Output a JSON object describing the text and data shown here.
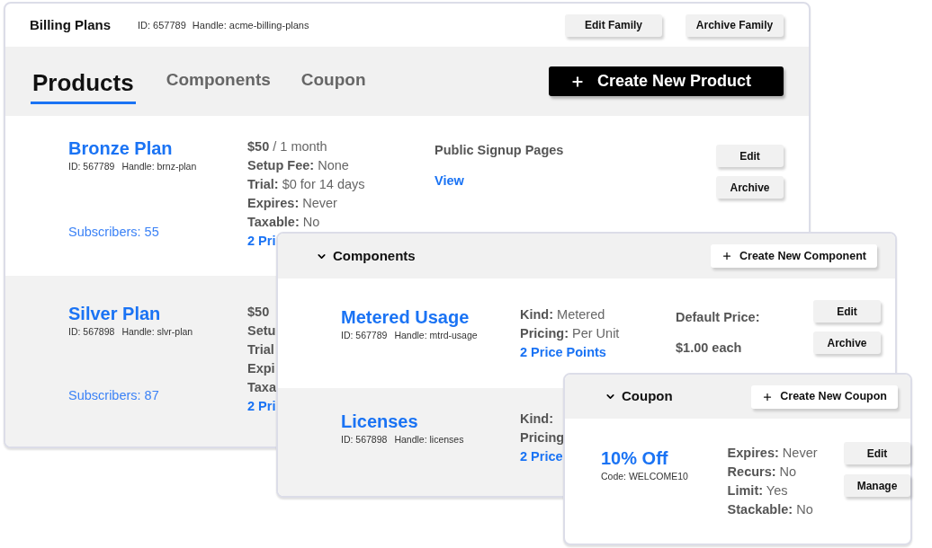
{
  "family": {
    "title": "Billing Plans",
    "id": "ID: 657789",
    "handle": "Handle: acme-billing-plans",
    "buttons": [
      "Edit Family",
      "Archive Family"
    ]
  },
  "tabs": [
    {
      "label": "Products",
      "selected": true
    },
    {
      "label": "Components",
      "selected": false
    },
    {
      "label": "Coupon",
      "selected": false
    }
  ],
  "create_product_button": "Create New Product",
  "products": [
    {
      "name": "Bronze Plan",
      "id": "ID: 567789",
      "handle": "Handle: brnz-plan",
      "subscribers": "Subscribers: 55",
      "details": [
        "**$50** / 1 month",
        "**Setup Fee:** None",
        "**Trial:** $0 for 14 days",
        "**Expires:** Never",
        "**Taxable:** No"
      ],
      "price_points": "2 Pri",
      "signup": {
        "title": "Public Signup Pages",
        "link": "View"
      },
      "buttons": [
        "Edit",
        "Archive"
      ]
    },
    {
      "name": "Silver Plan",
      "id": "ID: 567898",
      "handle": "Handle: slvr-plan",
      "subscribers": "Subscribers: 87",
      "details": [
        "**$50**",
        "**Setu**",
        "**Trial**",
        "**Expi**",
        "**Taxa**"
      ],
      "price_points": "2 Pri"
    }
  ],
  "components": {
    "title": "Components",
    "expanded": true,
    "create_button": "Create New Component",
    "items": [
      {
        "name": "Metered Usage",
        "id": "ID: 567789",
        "handle": "Handle: mtrd-usage",
        "details": [
          "**Kind:** Metered",
          "**Pricing:** Per Unit"
        ],
        "price_points": "2 Price Points",
        "default_price": {
          "label": "Default Price:",
          "value": "$1.00 each"
        },
        "buttons": [
          "Edit",
          "Archive"
        ]
      },
      {
        "name": "Licenses",
        "id": "ID: 567898",
        "handle": "Handle: licenses",
        "details": [
          "**Kind:**",
          "**Pricing**"
        ],
        "price_points": "2 Price"
      }
    ]
  },
  "coupons": {
    "title": "Coupon",
    "expanded": true,
    "create_button": "Create New Coupon",
    "items": [
      {
        "name": "10% Off",
        "code": "Code: WELCOME10",
        "details": [
          "**Expires:** Never",
          "**Recurs:** No",
          "**Limit:** Yes",
          "**Stackable:** No"
        ],
        "buttons": [
          "Edit",
          "Manage"
        ]
      }
    ]
  }
}
